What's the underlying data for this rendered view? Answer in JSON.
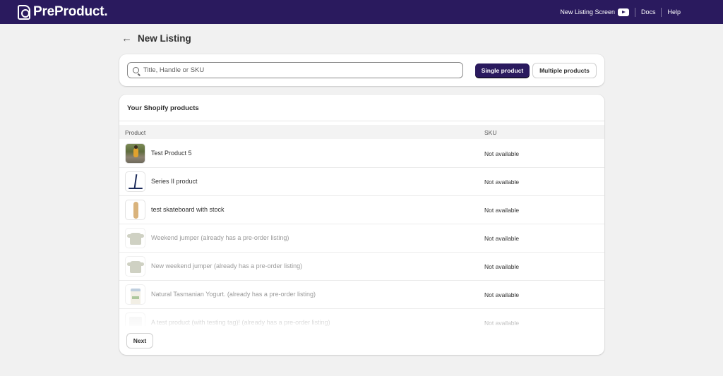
{
  "app": {
    "logo_text": "PreProduct.",
    "nav": {
      "screen_link": "New Listing Screen",
      "docs": "Docs",
      "help": "Help"
    }
  },
  "page": {
    "title": "New Listing"
  },
  "search": {
    "placeholder": "Title, Handle or SKU",
    "value": ""
  },
  "mode_buttons": {
    "single": "Single product",
    "multiple": "Multiple products",
    "selected": "single"
  },
  "products_card": {
    "heading": "Your Shopify products",
    "columns": [
      "Product",
      "SKU"
    ],
    "rows": [
      {
        "name": "Test Product 5",
        "sku": "Not available",
        "thumbnail": "person-photo",
        "disabled": false
      },
      {
        "name": "Series II product",
        "sku": "Not available",
        "thumbnail": "scooter",
        "disabled": false
      },
      {
        "name": "test skateboard with stock",
        "sku": "Not available",
        "thumbnail": "skateboard",
        "disabled": false
      },
      {
        "name": "Weekend jumper (already has a pre-order listing)",
        "sku": "Not available",
        "thumbnail": "jumper",
        "disabled": true
      },
      {
        "name": "New weekend jumper (already has a pre-order listing)",
        "sku": "Not available",
        "thumbnail": "jumper",
        "disabled": true
      },
      {
        "name": "Natural Tasmanian Yogurt. (already has a pre-order listing)",
        "sku": "Not available",
        "thumbnail": "yogurt",
        "disabled": true
      },
      {
        "name": "A test product (with testing tag)! (already has a pre-order listing)",
        "sku": "Not available",
        "thumbnail": "cup",
        "disabled": true
      }
    ],
    "next_label": "Next"
  },
  "colors": {
    "brand": "#2a1a5e",
    "background": "#f1f1f1"
  }
}
